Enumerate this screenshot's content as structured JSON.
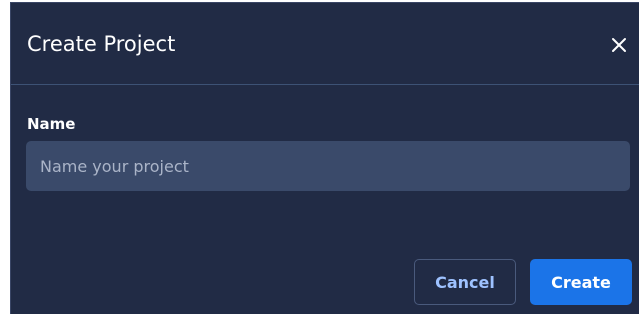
{
  "dialog": {
    "title": "Create Project",
    "close_icon": "close-icon"
  },
  "form": {
    "name_label": "Name",
    "name_placeholder": "Name your project",
    "name_value": ""
  },
  "actions": {
    "cancel_label": "Cancel",
    "create_label": "Create"
  },
  "colors": {
    "dialog_bg": "#212b45",
    "input_bg": "#3a4a6a",
    "primary": "#1b74e8",
    "secondary_text": "#9ec2ff"
  }
}
